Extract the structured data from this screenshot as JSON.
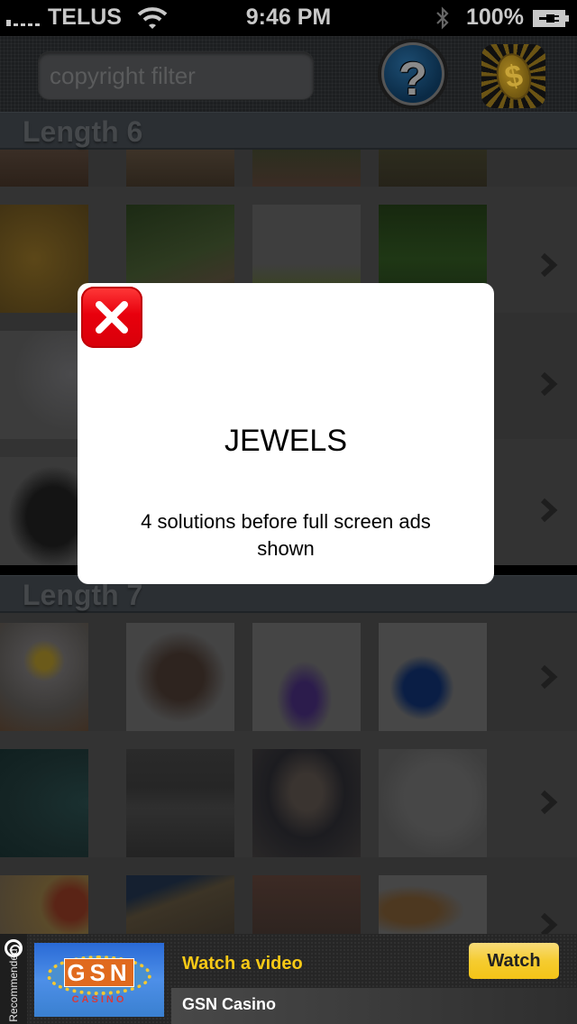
{
  "status_bar": {
    "carrier": "TELUS",
    "time": "9:46 PM",
    "battery": "100%",
    "signal_bars": 1,
    "icons": [
      "signal-icon",
      "wifi-icon",
      "bluetooth-icon",
      "battery-charging-icon"
    ]
  },
  "header": {
    "search_placeholder": "copyright filter",
    "search_value": "",
    "help_label": "?",
    "coin_label": "$"
  },
  "sections": [
    {
      "label": "Length 6",
      "rows": [
        {
          "thumbs": [
            "soil",
            "dry-grass",
            "grass-hand",
            "person-field"
          ]
        },
        {
          "thumbs": [
            "bees-honeycomb",
            "grasshopper",
            "caterpillar",
            "ladybug-dewdrops"
          ]
        },
        {
          "thumbs": [
            "diamonds",
            "",
            "",
            ""
          ]
        },
        {
          "thumbs": [
            "cowboy-hat",
            "",
            "",
            ""
          ]
        }
      ]
    },
    {
      "label": "Length 7",
      "rows": [
        {
          "thumbs": [
            "flour-eggs",
            "handbag-shoes",
            "chemistry-flask",
            "jigsaw-puzzle"
          ]
        },
        {
          "thumbs": [
            "tunnel",
            "bus-river",
            "iron-gate",
            "white-van"
          ]
        },
        {
          "thumbs": [
            "apples-honey",
            "rock-cliff",
            "brick-wall",
            "cookies"
          ]
        }
      ]
    }
  ],
  "modal": {
    "title": "JEWELS",
    "message": "4 solutions before full screen ads shown",
    "close_icon": "close-icon"
  },
  "ad": {
    "side_label": "Recommended",
    "headline": "Watch a video",
    "button_label": "Watch",
    "app_name": "GSN Casino",
    "image_text": "GSN",
    "image_subtext": "CASINO",
    "headline_color": "#f7c916",
    "button_color": "#f5cc30"
  }
}
